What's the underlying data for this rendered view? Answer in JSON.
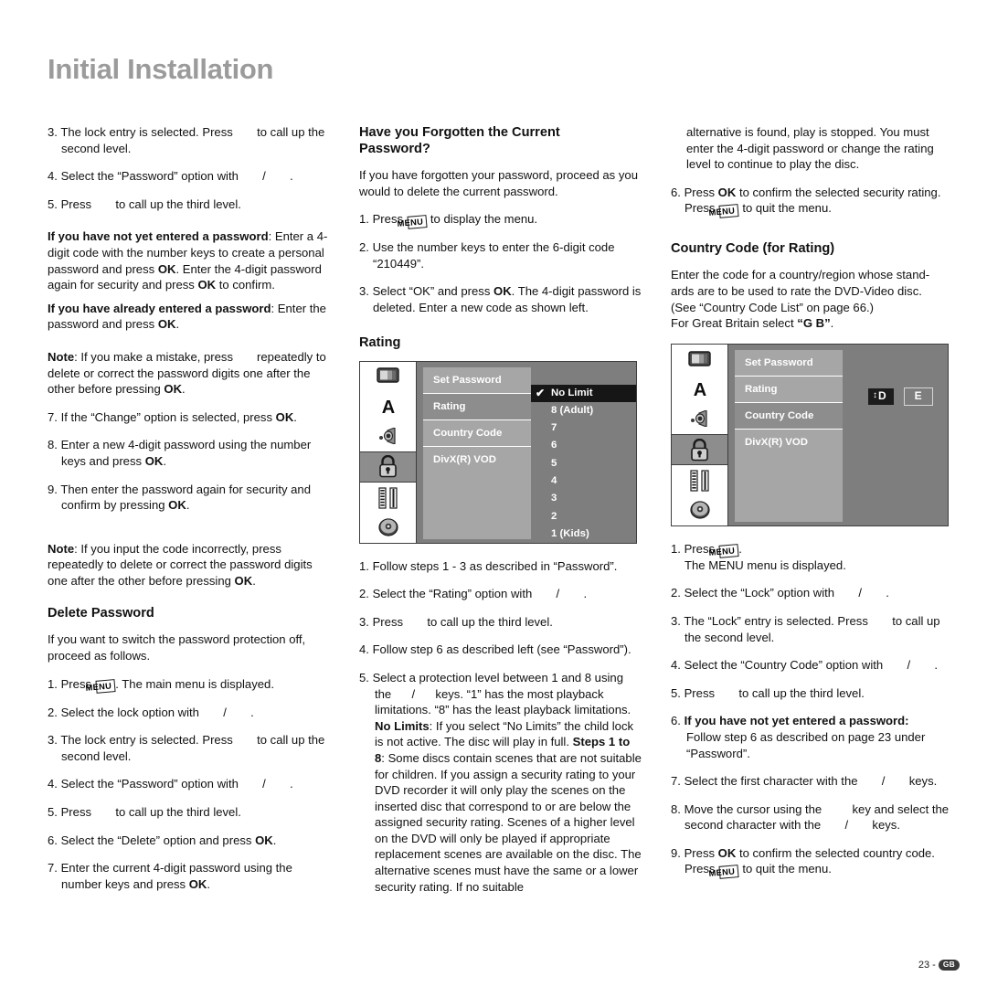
{
  "page": {
    "title": "Initial Installation",
    "footer_page_number": "23",
    "footer_separator": "-",
    "footer_region_code": "GB"
  },
  "left_column": {
    "step3": {
      "n": "3.",
      "a": "The lock entry is selected. Press",
      "b": "to call up the second level."
    },
    "step4": {
      "n": "4.",
      "a": "Select the “Password” option with",
      "slash": "/",
      "b": "."
    },
    "step5": {
      "n": "5.",
      "a": "Press",
      "b": "to call up the third level."
    },
    "not_yet_entered": {
      "bold": "If you have not yet entered a password",
      "text1": ": Enter a 4-digit code with the number keys to create a personal password and press ",
      "ok1": "OK",
      "text2": ". Enter the 4-digit password again for security and press ",
      "ok2": "OK",
      "text3": " to confirm."
    },
    "already_entered": {
      "bold": "If you have already entered a password",
      "text1": ": Enter the password and press ",
      "ok1": "OK",
      "text2": "."
    },
    "note1": {
      "bold": "Note",
      "text1": ": If you make a mistake, press",
      "text2": "repeatedly to delete or correct the password digits one after the other before pressing ",
      "ok": "OK",
      "text3": "."
    },
    "step7": {
      "n": "7.",
      "a": "If the “Change” option is selected, press ",
      "ok": "OK",
      "b": "."
    },
    "step8": {
      "n": "8.",
      "a": "Enter a new 4-digit password using the number keys and press ",
      "ok": "OK",
      "b": "."
    },
    "step9": {
      "n": "9.",
      "a": "Then enter the password again for security and confirm by pressing ",
      "ok": "OK",
      "b": "."
    },
    "note2": {
      "bold": "Note",
      "text1": ": If you input the code incorrectly, press",
      "text2": "repeatedly to delete or correct the password digits one after the other before pressing ",
      "ok": "OK",
      "text3": "."
    },
    "delete_password_heading": "Delete Password",
    "delete_intro": "If you want to switch the password protection off, proceed as follows.",
    "d_step1": {
      "n": "1.",
      "a": "Press ",
      "key": "MENU",
      "b": ". The main menu is displayed."
    },
    "d_step2": {
      "n": "2.",
      "a": "Select the lock option with",
      "slash": "/",
      "b": "."
    },
    "d_step3": {
      "n": "3.",
      "a": "The lock entry is selected. Press",
      "b": "to call up the second level."
    },
    "d_step4": {
      "n": "4.",
      "a": "Select the “Password” option with",
      "slash": "/",
      "b": "."
    },
    "d_step5": {
      "n": "5.",
      "a": "Press",
      "b": "to call up the third level."
    },
    "d_step6": {
      "n": "6.",
      "a": "Select the “Delete” option and press ",
      "ok": "OK",
      "b": "."
    },
    "d_step7": {
      "n": "7.",
      "a": "Enter the current 4-digit password using the number keys and press ",
      "ok": "OK",
      "b": "."
    }
  },
  "middle_column": {
    "forgotten_heading_l1": "Have you Forgotten the Current",
    "forgotten_heading_l2": "Password?",
    "forgotten_intro": "If you have forgotten your password, proceed as you would to delete the current password.",
    "f_step1": {
      "n": "1.",
      "a": "Press ",
      "key": "MENU",
      "b": " to display the menu."
    },
    "f_step2": {
      "n": "2.",
      "a": "Use the number keys to enter the 6-digit code “210449”."
    },
    "f_step3": {
      "n": "3.",
      "a": "Select “OK” and press ",
      "ok": "OK",
      "b": ". The 4-digit password is deleted. Enter a new code as shown left."
    },
    "rating_heading": "Rating",
    "r_step1": {
      "n": "1.",
      "a": "Follow steps 1 - 3 as described in “Password”."
    },
    "r_step2": {
      "n": "2.",
      "a": "Select the “Rating” option with",
      "slash": "/",
      "b": "."
    },
    "r_step3": {
      "n": "3.",
      "a": "Press",
      "b": "to call up the third level."
    },
    "r_step4": {
      "n": "4.",
      "a": "Follow step 6 as described left (see “Password”)."
    },
    "r_step5": {
      "n": "5.",
      "a": "Select a protection level between 1 and 8 using the",
      "slash": "/",
      "b": "keys. “1” has the most playback limitations. “8” has the least playback limitations. ",
      "nolimits_bold": "No Limits",
      "c": ": If you select “No Limits” the child lock is not active. The disc will play in full. ",
      "steps_bold": "Steps 1 to 8",
      "d": ": Some discs contain scenes that are not suitable for children. If you assign a security rating to your DVD recorder it will only play the scenes on the inserted disc that correspond to or are below the assigned security rating. Scenes of a higher level on the DVD will only be played if appropriate replacement scenes are available on the disc. The alternative scenes must have the same or a lower security rating. If no suitable"
    }
  },
  "right_column": {
    "continuation": "alternative is found, play is stopped. You must enter the 4-digit password or change the rating level to continue to play the disc.",
    "c_step6": {
      "n": "6.",
      "a": "Press ",
      "ok": "OK",
      "b": " to confirm the selected security rating. Press ",
      "key": "MENU",
      "c": " to quit the menu."
    },
    "country_heading": "Country Code (for Rating)",
    "country_intro_l1": "Enter the code for a country/region whose stand-",
    "country_intro_l2": "ards are to be used to rate the DVD-Video disc.",
    "country_intro_l3": "(See “Country Code List” on page 66.)",
    "country_intro_l4a": "For Great Britain select ",
    "country_intro_l4b": "“G B”",
    "country_intro_l4c": ".",
    "cc_step1": {
      "n": "1.",
      "a": "Press ",
      "key": "MENU",
      "b": ".",
      "c": "The MENU menu is displayed."
    },
    "cc_step2": {
      "n": "2.",
      "a": "Select the “Lock” option with",
      "slash": "/",
      "b": "."
    },
    "cc_step3": {
      "n": "3.",
      "a": "The “Lock” entry is selected. Press",
      "b": "to call up the second level."
    },
    "cc_step4": {
      "n": "4.",
      "a": "Select the “Country Code” option with",
      "slash": "/",
      "b": "."
    },
    "cc_step5": {
      "n": "5.",
      "a": "Press",
      "b": "to call up the third level."
    },
    "cc_step6": {
      "n": "6.",
      "bold": "If you have not yet entered a password:",
      "a": "Follow step 6 as described on page 23 under “Password”."
    },
    "cc_step7": {
      "n": "7.",
      "a": "Select the first character with the",
      "slash": "/",
      "b": "keys."
    },
    "cc_step8": {
      "n": "8.",
      "a": "Move the cursor using the",
      "b": "key and select the second character with the",
      "slash": "/",
      "c": "keys."
    },
    "cc_step9": {
      "n": "9.",
      "a": "Press ",
      "ok": "OK",
      "b": " to confirm the selected country code. Press ",
      "key": "MENU",
      "c": " to quit the menu."
    }
  },
  "osd_rating": {
    "rail_icons": [
      "tv-icon",
      "language-a-icon",
      "audio-speaker-icon",
      "lock-icon",
      "film-strip-icon",
      "disc-icon"
    ],
    "rail_active_index": 3,
    "menu_items": [
      {
        "label": "Set Password",
        "selected": false
      },
      {
        "label": "Rating",
        "selected": true
      },
      {
        "label": "Country Code",
        "selected": false
      },
      {
        "label": "DivX(R) VOD",
        "selected": false
      }
    ],
    "options": [
      {
        "label": "No Limit",
        "selected": true,
        "check": "✔"
      },
      {
        "label": "8 (Adult)",
        "selected": false
      },
      {
        "label": "7",
        "selected": false
      },
      {
        "label": "6",
        "selected": false
      },
      {
        "label": "5",
        "selected": false
      },
      {
        "label": "4",
        "selected": false
      },
      {
        "label": "3",
        "selected": false
      },
      {
        "label": "2",
        "selected": false
      },
      {
        "label": "1 (Kids)",
        "selected": false
      }
    ]
  },
  "osd_country": {
    "rail_icons": [
      "tv-icon",
      "language-a-icon",
      "audio-speaker-icon",
      "lock-icon",
      "film-strip-icon",
      "disc-icon"
    ],
    "rail_active_index": 3,
    "menu_items": [
      {
        "label": "Set Password",
        "selected": false
      },
      {
        "label": "Rating",
        "selected": false
      },
      {
        "label": "Country Code",
        "selected": true
      },
      {
        "label": "DivX(R) VOD",
        "selected": false
      }
    ],
    "char1": "D",
    "char1_arrows": "↕",
    "char2": "E"
  },
  "colors": {
    "title_gray": "#9b9b9b",
    "osd_bg": "#7e7e7e",
    "osd_list": "#a6a6a6",
    "osd_selected": "#8d8d8d",
    "osd_option_selected": "#161616",
    "text": "#111111"
  }
}
